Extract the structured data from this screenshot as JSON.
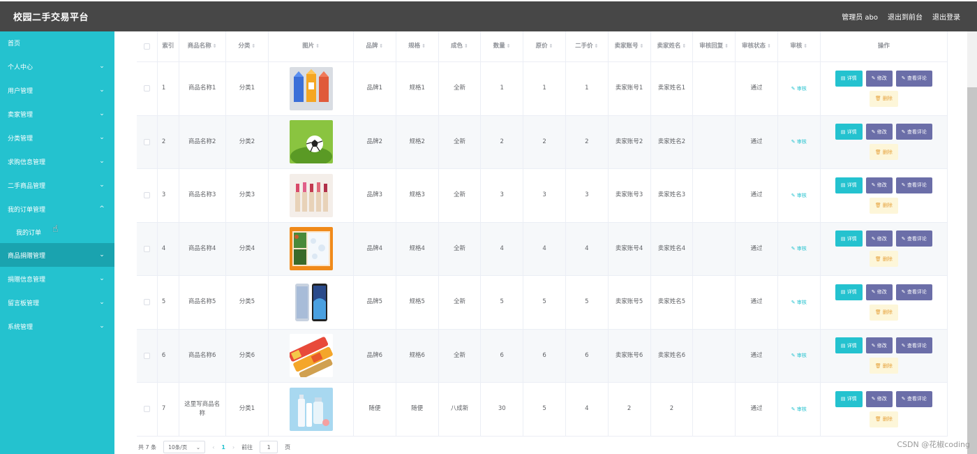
{
  "header": {
    "title": "校园二手交易平台",
    "admin": "管理员 abo",
    "to_front": "退出到前台",
    "logout": "退出登录"
  },
  "sidebar": {
    "items": [
      {
        "label": "首页",
        "chevron": ""
      },
      {
        "label": "个人中心",
        "chevron": "⌄"
      },
      {
        "label": "用户管理",
        "chevron": "⌄"
      },
      {
        "label": "卖家管理",
        "chevron": "⌄"
      },
      {
        "label": "分类管理",
        "chevron": "⌄"
      },
      {
        "label": "求购信息管理",
        "chevron": "⌄"
      },
      {
        "label": "二手商品管理",
        "chevron": "⌄"
      },
      {
        "label": "我的订单管理",
        "chevron": "^"
      },
      {
        "label": "我的订单",
        "chevron": ""
      },
      {
        "label": "商品捐赠管理",
        "chevron": "⌄"
      },
      {
        "label": "捐赠信息管理",
        "chevron": "⌄"
      },
      {
        "label": "留言板管理",
        "chevron": "⌄"
      },
      {
        "label": "系统管理",
        "chevron": "⌄"
      }
    ]
  },
  "table": {
    "headers": [
      "索引",
      "商品名称",
      "分类",
      "图片",
      "品牌",
      "规格",
      "成色",
      "数量",
      "原价",
      "二手价",
      "卖家账号",
      "卖家姓名",
      "审核回复",
      "审核状态",
      "审核",
      "操作"
    ],
    "sort_icon": "⇕",
    "audit_label": "✎ 审核",
    "btn_detail": "▤ 详情",
    "btn_edit": "✎ 修改",
    "btn_review": "✎ 查看评论",
    "btn_delete": "🗑 删除",
    "rows": [
      {
        "idx": "1",
        "name": "商品名称1",
        "cat": "分类1",
        "img": "milk",
        "brand": "品牌1",
        "spec": "规格1",
        "cond": "全新",
        "qty": "1",
        "orig": "1",
        "second": "1",
        "acct": "卖家账号1",
        "seller": "卖家姓名1",
        "reply": "",
        "status": "通过"
      },
      {
        "idx": "2",
        "name": "商品名称2",
        "cat": "分类2",
        "img": "ball",
        "brand": "品牌2",
        "spec": "规格2",
        "cond": "全新",
        "qty": "2",
        "orig": "2",
        "second": "2",
        "acct": "卖家账号2",
        "seller": "卖家姓名2",
        "reply": "",
        "status": "通过"
      },
      {
        "idx": "3",
        "name": "商品名称3",
        "cat": "分类3",
        "img": "lipstick",
        "brand": "品牌3",
        "spec": "规格3",
        "cond": "全新",
        "qty": "3",
        "orig": "3",
        "second": "3",
        "acct": "卖家账号3",
        "seller": "卖家姓名3",
        "reply": "",
        "status": "通过"
      },
      {
        "idx": "4",
        "name": "商品名称4",
        "cat": "分类4",
        "img": "lunchbox",
        "brand": "品牌4",
        "spec": "规格4",
        "cond": "全新",
        "qty": "4",
        "orig": "4",
        "second": "4",
        "acct": "卖家账号4",
        "seller": "卖家姓名4",
        "reply": "",
        "status": "通过"
      },
      {
        "idx": "5",
        "name": "商品名称5",
        "cat": "分类5",
        "img": "phone",
        "brand": "品牌5",
        "spec": "规格5",
        "cond": "全新",
        "qty": "5",
        "orig": "5",
        "second": "5",
        "acct": "卖家账号5",
        "seller": "卖家姓名5",
        "reply": "",
        "status": "通过"
      },
      {
        "idx": "6",
        "name": "商品名称6",
        "cat": "分类6",
        "img": "snack",
        "brand": "品牌6",
        "spec": "规格6",
        "cond": "全新",
        "qty": "6",
        "orig": "6",
        "second": "6",
        "acct": "卖家账号6",
        "seller": "卖家姓名6",
        "reply": "",
        "status": "通过"
      },
      {
        "idx": "7",
        "name": "这里写商品名称",
        "cat": "分类1",
        "img": "cosmetics",
        "brand": "随便",
        "spec": "随便",
        "cond": "八成新",
        "qty": "30",
        "orig": "5",
        "second": "4",
        "acct": "2",
        "seller": "2",
        "reply": "",
        "status": "通过"
      }
    ]
  },
  "pager": {
    "total": "共 7 条",
    "size": "10条/页",
    "prev": "‹",
    "page": "1",
    "next": "›",
    "goto_label": "前往",
    "goto_value": "1",
    "goto_unit": "页"
  },
  "watermark": "CSDN @花椒coding",
  "colors": {
    "topbar": "#474747",
    "sidebar": "#24c2cf",
    "sidebar_active": "#1aa3af",
    "btn_detail": "#24c2cf",
    "btn_edit": "#6b6ea8",
    "btn_delete_bg": "#fdf6d9"
  }
}
